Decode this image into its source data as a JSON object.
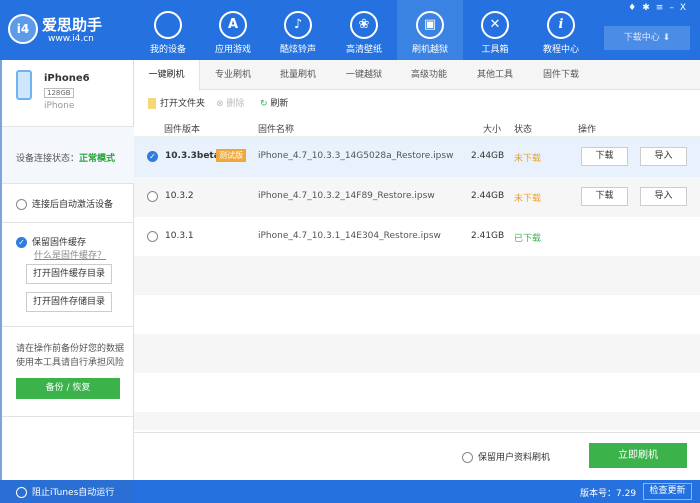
{
  "app": {
    "name": "爱思助手",
    "url": "www.i4.cn"
  },
  "window_controls": [
    "shirt-icon",
    "gear-icon",
    "menu-icon",
    "minimize-icon",
    "close-icon"
  ],
  "nav": [
    {
      "label": "我的设备",
      "icon": "apple-icon"
    },
    {
      "label": "应用游戏",
      "icon": "appstore-icon"
    },
    {
      "label": "酷炫铃声",
      "icon": "bell-icon"
    },
    {
      "label": "高清壁纸",
      "icon": "flower-icon"
    },
    {
      "label": "刷机越狱",
      "icon": "box-icon",
      "active": true
    },
    {
      "label": "工具箱",
      "icon": "tools-icon"
    },
    {
      "label": "教程中心",
      "icon": "info-icon"
    }
  ],
  "download_center": "下载中心",
  "device": {
    "name": "iPhone6",
    "capacity": "128GB",
    "type": "iPhone"
  },
  "sidebar": {
    "status_label": "设备连接状态：",
    "status_value": "正常模式",
    "auto_activate": "连接后自动激活设备",
    "keep_cache": "保留固件缓存",
    "cache_link": "什么是固件缓存？",
    "open_cache_dir": "打开固件缓存目录",
    "open_store_dir": "打开固件存储目录",
    "warning_1": "请在操作前备份好您的数据",
    "warning_2": "使用本工具请自行承担风险",
    "backup_button": "备份 / 恢复"
  },
  "tabs": [
    "一键刷机",
    "专业刷机",
    "批量刷机",
    "一键越狱",
    "高级功能",
    "其他工具",
    "固件下载"
  ],
  "toolbar": {
    "open_folder": "打开文件夹",
    "delete": "删除",
    "refresh": "刷新"
  },
  "table": {
    "headers": [
      "固件版本",
      "固件名称",
      "大小",
      "状态",
      "操作"
    ],
    "rows": [
      {
        "version": "10.3.3beta",
        "badge": "测试版",
        "name": "iPhone_4.7_10.3.3_14G5028a_Restore.ipsw",
        "size": "2.44GB",
        "status": "未下载",
        "download": "下载",
        "import": "导入",
        "selected": true
      },
      {
        "version": "10.3.2",
        "name": "iPhone_4.7_10.3.2_14F89_Restore.ipsw",
        "size": "2.44GB",
        "status": "未下载",
        "download": "下载",
        "import": "导入"
      },
      {
        "version": "10.3.1",
        "name": "iPhone_4.7_10.3.1_14E304_Restore.ipsw",
        "size": "2.41GB",
        "status": "已下载"
      }
    ]
  },
  "bottom": {
    "keep_data": "保留用户资料刷机",
    "flash_now": "立即刷机"
  },
  "statusbar": {
    "block_itunes": "阻止iTunes自动运行",
    "version": "版本号：7.29",
    "check_update": "检查更新"
  },
  "colors": {
    "brand": "#2471df",
    "green": "#3bb34a",
    "orange": "#f0a020"
  }
}
